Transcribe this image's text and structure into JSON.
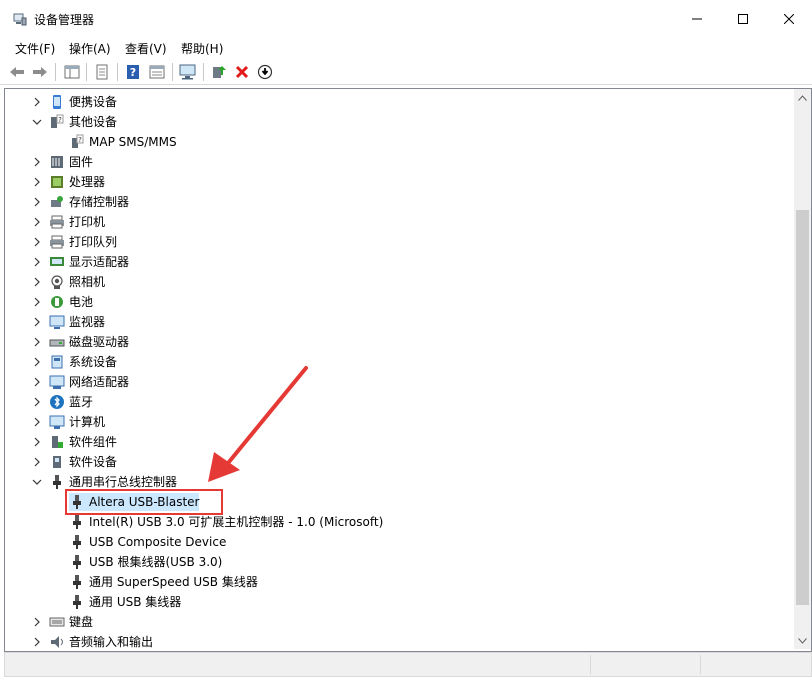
{
  "window": {
    "title": "设备管理器"
  },
  "menu": [
    "文件(F)",
    "操作(A)",
    "查看(V)",
    "帮助(H)"
  ],
  "toolbar": [
    {
      "name": "back-arrow-icon"
    },
    {
      "name": "forward-arrow-icon"
    },
    {
      "name": "show-hide-console-tree-icon"
    },
    {
      "name": "properties-icon"
    },
    {
      "name": "help-icon"
    },
    {
      "name": "view-toggle-icon"
    },
    {
      "name": "monitor-scan-icon"
    },
    {
      "name": "update-driver-icon"
    },
    {
      "name": "uninstall-icon"
    },
    {
      "name": "download-circle-icon"
    }
  ],
  "tree": {
    "items": [
      {
        "label": "便携设备",
        "expand": "collapsed",
        "level": 0,
        "icon": "portable-device-icon"
      },
      {
        "label": "其他设备",
        "expand": "expanded",
        "level": 0,
        "icon": "other-device-icon"
      },
      {
        "label": "MAP SMS/MMS",
        "expand": "none",
        "level": 1,
        "icon": "unknown-device-icon"
      },
      {
        "label": "固件",
        "expand": "collapsed",
        "level": 0,
        "icon": "firmware-icon"
      },
      {
        "label": "处理器",
        "expand": "collapsed",
        "level": 0,
        "icon": "processor-icon"
      },
      {
        "label": "存储控制器",
        "expand": "collapsed",
        "level": 0,
        "icon": "storage-controller-icon"
      },
      {
        "label": "打印机",
        "expand": "collapsed",
        "level": 0,
        "icon": "printer-icon"
      },
      {
        "label": "打印队列",
        "expand": "collapsed",
        "level": 0,
        "icon": "print-queue-icon"
      },
      {
        "label": "显示适配器",
        "expand": "collapsed",
        "level": 0,
        "icon": "display-adapter-icon"
      },
      {
        "label": "照相机",
        "expand": "collapsed",
        "level": 0,
        "icon": "camera-icon"
      },
      {
        "label": "电池",
        "expand": "collapsed",
        "level": 0,
        "icon": "battery-icon"
      },
      {
        "label": "监视器",
        "expand": "collapsed",
        "level": 0,
        "icon": "monitor-icon"
      },
      {
        "label": "磁盘驱动器",
        "expand": "collapsed",
        "level": 0,
        "icon": "disk-drive-icon"
      },
      {
        "label": "系统设备",
        "expand": "collapsed",
        "level": 0,
        "icon": "system-device-icon"
      },
      {
        "label": "网络适配器",
        "expand": "collapsed",
        "level": 0,
        "icon": "network-adapter-icon"
      },
      {
        "label": "蓝牙",
        "expand": "collapsed",
        "level": 0,
        "icon": "bluetooth-icon"
      },
      {
        "label": "计算机",
        "expand": "collapsed",
        "level": 0,
        "icon": "computer-icon"
      },
      {
        "label": "软件组件",
        "expand": "collapsed",
        "level": 0,
        "icon": "software-component-icon"
      },
      {
        "label": "软件设备",
        "expand": "collapsed",
        "level": 0,
        "icon": "software-device-icon"
      },
      {
        "label": "通用串行总线控制器",
        "expand": "expanded",
        "level": 0,
        "icon": "usb-controller-icon"
      },
      {
        "label": "Altera USB-Blaster",
        "expand": "none",
        "level": 1,
        "icon": "usb-plug-icon",
        "selected": true
      },
      {
        "label": "Intel(R) USB 3.0 可扩展主机控制器 - 1.0 (Microsoft)",
        "expand": "none",
        "level": 1,
        "icon": "usb-plug-icon"
      },
      {
        "label": "USB Composite Device",
        "expand": "none",
        "level": 1,
        "icon": "usb-plug-icon"
      },
      {
        "label": "USB 根集线器(USB 3.0)",
        "expand": "none",
        "level": 1,
        "icon": "usb-plug-icon"
      },
      {
        "label": "通用 SuperSpeed USB 集线器",
        "expand": "none",
        "level": 1,
        "icon": "usb-plug-icon"
      },
      {
        "label": "通用 USB 集线器",
        "expand": "none",
        "level": 1,
        "icon": "usb-plug-icon"
      },
      {
        "label": "键盘",
        "expand": "collapsed",
        "level": 0,
        "icon": "keyboard-icon"
      },
      {
        "label": "音频输入和输出",
        "expand": "collapsed",
        "level": 0,
        "icon": "audio-io-icon"
      }
    ]
  },
  "colors": {
    "selection": "#cce8ff",
    "annotation": "#e53935",
    "accent_blue": "#1e73be"
  }
}
